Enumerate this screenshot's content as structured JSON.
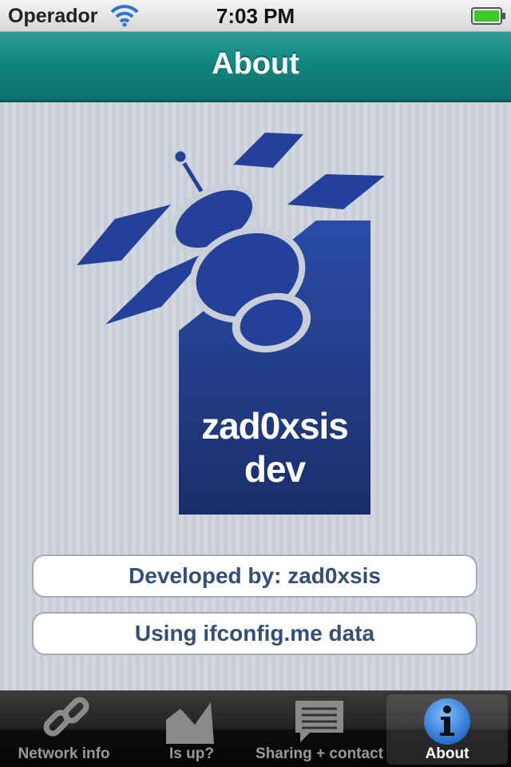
{
  "status": {
    "carrier": "Operador",
    "time": "7:03 PM"
  },
  "nav": {
    "title": "About"
  },
  "logo": {
    "line1": "zad0xsis",
    "line2": "dev",
    "color": "#1f3a88"
  },
  "info": {
    "developer": "Developed by: zad0xsis",
    "data_source": "Using ifconfig.me data"
  },
  "tabs": [
    {
      "label": "Network info",
      "icon": "chain-link-icon"
    },
    {
      "label": "Is up?",
      "icon": "graph-icon"
    },
    {
      "label": "Sharing + contact",
      "icon": "speech-bubble-icon"
    },
    {
      "label": "About",
      "icon": "info-icon",
      "selected": true
    }
  ],
  "colors": {
    "nav": "#138681",
    "pill_text": "#344e7c"
  }
}
